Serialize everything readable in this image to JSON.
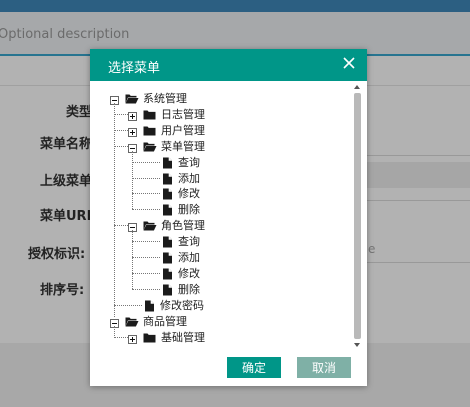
{
  "page": {
    "description_placeholder": "Optional description",
    "form_labels": {
      "type": "类型",
      "menu_name": "菜单名称",
      "parent_menu": "上级菜单",
      "menu_url": "菜单URL",
      "permission": "授权标识:",
      "sort_order": "排序号:"
    },
    "permission_placeholder_fragment": "e"
  },
  "modal": {
    "title": "选择菜单",
    "ok_label": "确定",
    "cancel_label": "取消",
    "header_color": "#009688"
  },
  "tree": [
    {
      "label": "系统管理",
      "depth": 0,
      "expanded": true,
      "type": "folder"
    },
    {
      "label": "日志管理",
      "depth": 1,
      "expanded": false,
      "type": "folder"
    },
    {
      "label": "用户管理",
      "depth": 1,
      "expanded": false,
      "type": "folder"
    },
    {
      "label": "菜单管理",
      "depth": 1,
      "expanded": true,
      "type": "folder"
    },
    {
      "label": "查询",
      "depth": 2,
      "type": "file"
    },
    {
      "label": "添加",
      "depth": 2,
      "type": "file"
    },
    {
      "label": "修改",
      "depth": 2,
      "type": "file"
    },
    {
      "label": "删除",
      "depth": 2,
      "type": "file"
    },
    {
      "label": "角色管理",
      "depth": 1,
      "expanded": true,
      "type": "folder"
    },
    {
      "label": "查询",
      "depth": 2,
      "type": "file"
    },
    {
      "label": "添加",
      "depth": 2,
      "type": "file"
    },
    {
      "label": "修改",
      "depth": 2,
      "type": "file"
    },
    {
      "label": "删除",
      "depth": 2,
      "type": "file"
    },
    {
      "label": "修改密码",
      "depth": 1,
      "type": "file"
    },
    {
      "label": "商品管理",
      "depth": 0,
      "expanded": true,
      "type": "folder"
    },
    {
      "label": "基础管理",
      "depth": 1,
      "expanded": false,
      "type": "folder"
    }
  ]
}
